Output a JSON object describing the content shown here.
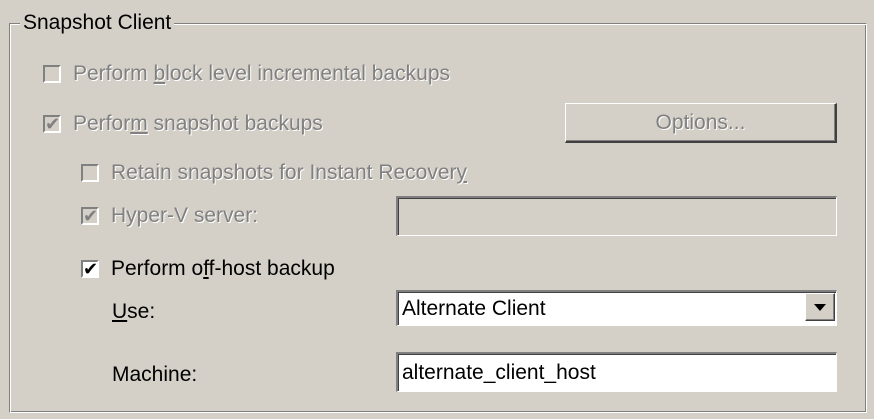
{
  "group": {
    "title": "Snapshot Client"
  },
  "block_level": {
    "label_before": "Perform ",
    "label_mnemonic": "b",
    "label_after": "lock level incremental backups",
    "checked": false,
    "enabled": false
  },
  "snapshot_backups": {
    "label_before": "Perfor",
    "label_mnemonic": "m",
    "label_after": " snapshot backups",
    "checked": true,
    "enabled": false
  },
  "options_button": {
    "label": "Options...",
    "enabled": false
  },
  "retain_snapshots": {
    "label_before": "Retain snapshots for Instant Recover",
    "label_mnemonic": "y",
    "label_after": "",
    "checked": false,
    "enabled": false
  },
  "hyperv": {
    "label": "Hyper-V server:",
    "checked": true,
    "enabled": false,
    "value": ""
  },
  "offhost": {
    "label_before": "Perform o",
    "label_mnemonic": "f",
    "label_after": "f-host backup",
    "checked": true,
    "enabled": true
  },
  "use": {
    "label_mnemonic": "U",
    "label_after": "se:",
    "selected": "Alternate Client"
  },
  "machine": {
    "label": "Machine:",
    "value": "alternate_client_host"
  },
  "icons": {
    "check": "checkmark-icon",
    "dropdown": "triangle-down-icon"
  },
  "colors": {
    "face": "#d4d0c8",
    "disabled_text": "#808080",
    "field_bg": "#ffffff"
  }
}
